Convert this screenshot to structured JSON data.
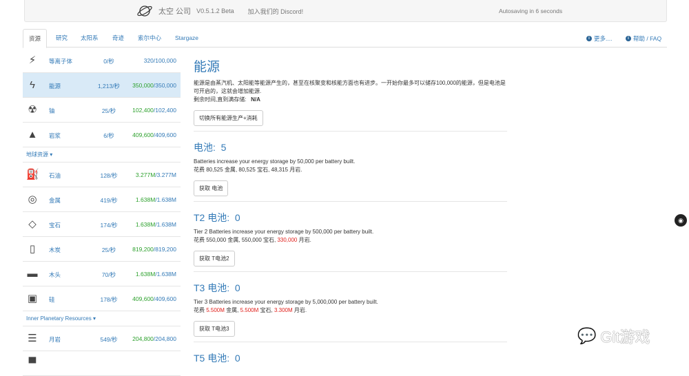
{
  "header": {
    "name": "太空 公司",
    "version": "V0.5.1.2 Beta",
    "discord": "加入我们的 Discord!",
    "autosave": "Autosaving in 6 seconds"
  },
  "tabs": [
    "资源",
    "研究",
    "太阳系",
    "奇迹",
    "索尔中心",
    "Stargaze"
  ],
  "tabs_right": {
    "more": "更多....",
    "help": "帮助 / FAQ"
  },
  "sidebar": [
    {
      "type": "row",
      "icon": "plasma-icon",
      "glyph": "⚡",
      "name": "等离子体",
      "rate": "0/秒",
      "amount": "320",
      "max": "/100,000",
      "full": false
    },
    {
      "type": "row",
      "icon": "energy-icon",
      "glyph": "ϟ",
      "name": "能源",
      "rate": "1,213/秒",
      "amount": "350,000",
      "max": "/350,000",
      "full": true,
      "active": true
    },
    {
      "type": "row",
      "icon": "uranium-icon",
      "glyph": "☢",
      "name": "铀",
      "rate": "25/秒",
      "amount": "102,400",
      "max": "/102,400",
      "full": true
    },
    {
      "type": "row",
      "icon": "lava-icon",
      "glyph": "▲",
      "name": "岩浆",
      "rate": "6/秒",
      "amount": "409,600",
      "max": "/409,600",
      "full": true
    },
    {
      "type": "group",
      "label": "地球资源 ▾"
    },
    {
      "type": "row",
      "icon": "oil-icon",
      "glyph": "⛽",
      "name": "石油",
      "rate": "128/秒",
      "amount": "3.277M",
      "max": "/3.277M",
      "full": true
    },
    {
      "type": "row",
      "icon": "metal-icon",
      "glyph": "◎",
      "name": "金属",
      "rate": "419/秒",
      "amount": "1.638M",
      "max": "/1.638M",
      "full": true
    },
    {
      "type": "row",
      "icon": "gem-icon",
      "glyph": "◇",
      "name": "宝石",
      "rate": "174/秒",
      "amount": "1.638M",
      "max": "/1.638M",
      "full": true
    },
    {
      "type": "row",
      "icon": "charcoal-icon",
      "glyph": "▯",
      "name": "木炭",
      "rate": "25/秒",
      "amount": "819,200",
      "max": "/819,200",
      "full": true
    },
    {
      "type": "row",
      "icon": "wood-icon",
      "glyph": "▬",
      "name": "木头",
      "rate": "70/秒",
      "amount": "1.638M",
      "max": "/1.638M",
      "full": true
    },
    {
      "type": "row",
      "icon": "silicon-icon",
      "glyph": "▣",
      "name": "硅",
      "rate": "178/秒",
      "amount": "409,600",
      "max": "/409,600",
      "full": true
    },
    {
      "type": "group",
      "label": "Inner Planetary Resources ▾"
    },
    {
      "type": "row",
      "icon": "moonrock-icon",
      "glyph": "☰",
      "name": "月岩",
      "rate": "549/秒",
      "amount": "204,800",
      "max": "/204,800",
      "full": true
    },
    {
      "type": "row",
      "icon": "resource-icon",
      "glyph": "▀",
      "name": "",
      "rate": "",
      "amount": "",
      "max": "",
      "full": false
    }
  ],
  "main": {
    "title": "能源",
    "desc": "能源是由蒸汽机、太阳能等能源产生的，甚至在核聚变和核能方面也有进步。一开始你最多可以储存100,000的能源，但是电池是可开启的，这就会增加能源.",
    "time_label": "剩余时间,直到满存储:",
    "time_value": "N/A",
    "toggle_button": "切换所有能源生产+消耗",
    "sections": [
      {
        "title": "电池:",
        "count": "5",
        "desc": "Batteries increase your energy storage by 50,000 per battery built.",
        "cost_prefix": "花费",
        "costs": [
          {
            "v": "80,525",
            "u": "金属",
            "red": false
          },
          {
            "v": "80,525",
            "u": "宝石",
            "red": false
          },
          {
            "v": "48,315",
            "u": "月岩",
            "red": false
          }
        ],
        "button": "获取 电池"
      },
      {
        "title": "T2 电池:",
        "count": "0",
        "desc": "Tier 2 Batteries increase your energy storage by 500,000 per battery built.",
        "cost_prefix": "花费",
        "costs": [
          {
            "v": "550,000",
            "u": "金属",
            "red": false
          },
          {
            "v": "550,000",
            "u": "宝石",
            "red": false
          },
          {
            "v": "330,000",
            "u": "月岩",
            "red": true
          }
        ],
        "button": "获取 T电池2"
      },
      {
        "title": "T3 电池:",
        "count": "0",
        "desc": "Tier 3 Batteries increase your energy storage by 5,000,000 per battery built.",
        "cost_prefix": "花费",
        "costs": [
          {
            "v": "5.500M",
            "u": "金属",
            "red": true
          },
          {
            "v": "5.500M",
            "u": "宝石",
            "red": true
          },
          {
            "v": "3.300M",
            "u": "月岩",
            "red": true
          }
        ],
        "button": "获取 T电池3"
      },
      {
        "title": "T5 电池:",
        "count": "0"
      }
    ]
  },
  "watermark": "Git游戏",
  "colors": {
    "accent": "#337ab7",
    "full": "#2ca02c",
    "insufficient": "#e0201b",
    "active_row": "#d9eaf7"
  }
}
